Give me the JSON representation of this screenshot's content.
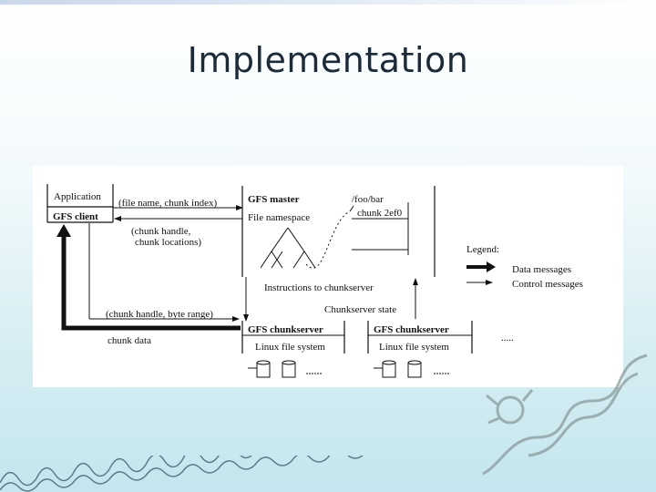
{
  "slide": {
    "title": "Implementation"
  },
  "diagram": {
    "application": "Application",
    "gfs_client": "GFS client",
    "request": "(file name, chunk index)",
    "reply_line1": "(chunk handle,",
    "reply_line2": "chunk locations)",
    "gfs_master": "GFS master",
    "file_namespace": "File namespace",
    "path": "/foo/bar",
    "chunk_id": "chunk 2ef0",
    "instructions": "Instructions to chunkserver",
    "chunkserver_state": "Chunkserver state",
    "handle_range": "(chunk handle, byte range)",
    "chunk_data": "chunk data",
    "chunkserver_1": "GFS chunkserver",
    "chunkserver_2": "GFS chunkserver",
    "linux_fs_1": "Linux file system",
    "linux_fs_2": "Linux file system",
    "legend_title": "Legend:",
    "legend_data": "Data messages",
    "legend_control": "Control messages"
  }
}
